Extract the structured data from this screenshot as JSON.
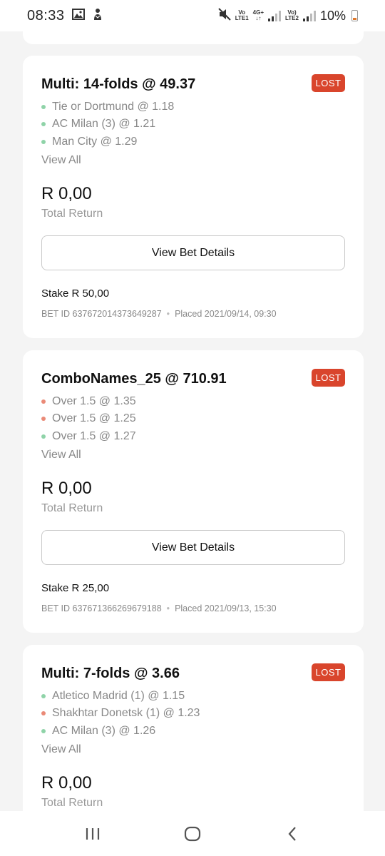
{
  "status_bar": {
    "time": "08:33",
    "network_1": "Vo\nLTE1",
    "network_1_top": "Vo",
    "network_1_bottom": "LTE1",
    "network_2_top": "4G+",
    "network_2_bottom": "↓↑",
    "network_3_top": "Vo)",
    "network_3_bottom": "LTE2",
    "battery_percent": "10%",
    "icons": [
      "gallery-icon",
      "notification-app-icon",
      "mute-icon",
      "signal-icon",
      "battery-icon"
    ],
    "battery_color": "#e0782a"
  },
  "bets": [
    {
      "title": "Multi: 14-folds @ 49.37",
      "status": "LOST",
      "legs": [
        {
          "text": "Tie or Dortmund @ 1.18",
          "result": "green"
        },
        {
          "text": "AC Milan (3) @ 1.21",
          "result": "green"
        },
        {
          "text": "Man City @ 1.29",
          "result": "green"
        }
      ],
      "view_all": "View All",
      "total_return_amount": "R 0,00",
      "total_return_label": "Total Return",
      "details_button": "View Bet Details",
      "stake": "Stake R 50,00",
      "bet_id": "BET ID  637672014373649287",
      "placed": "Placed  2021/09/14, 09:30"
    },
    {
      "title": "ComboNames_25 @ 710.91",
      "status": "LOST",
      "legs": [
        {
          "text": "Over 1.5 @ 1.35",
          "result": "red"
        },
        {
          "text": "Over 1.5 @ 1.25",
          "result": "red"
        },
        {
          "text": "Over 1.5 @ 1.27",
          "result": "green"
        }
      ],
      "view_all": "View All",
      "total_return_amount": "R 0,00",
      "total_return_label": "Total Return",
      "details_button": "View Bet Details",
      "stake": "Stake R 25,00",
      "bet_id": "BET ID  637671366269679188",
      "placed": "Placed  2021/09/13, 15:30"
    },
    {
      "title": "Multi: 7-folds @ 3.66",
      "status": "LOST",
      "legs": [
        {
          "text": "Atletico Madrid (1) @ 1.15",
          "result": "green"
        },
        {
          "text": "Shakhtar Donetsk (1) @ 1.23",
          "result": "red"
        },
        {
          "text": "AC Milan (3) @ 1.26",
          "result": "green"
        }
      ],
      "view_all": "View All",
      "total_return_amount": "R 0,00",
      "total_return_label": "Total Return"
    }
  ],
  "colors": {
    "lost_badge": "#d9452c",
    "win_dot": "#8fd3a8",
    "loss_dot": "#ea8a77",
    "background": "#f4f4f4"
  },
  "nav_bar": {
    "icons": [
      "recent-apps-icon",
      "home-icon",
      "back-icon"
    ]
  }
}
